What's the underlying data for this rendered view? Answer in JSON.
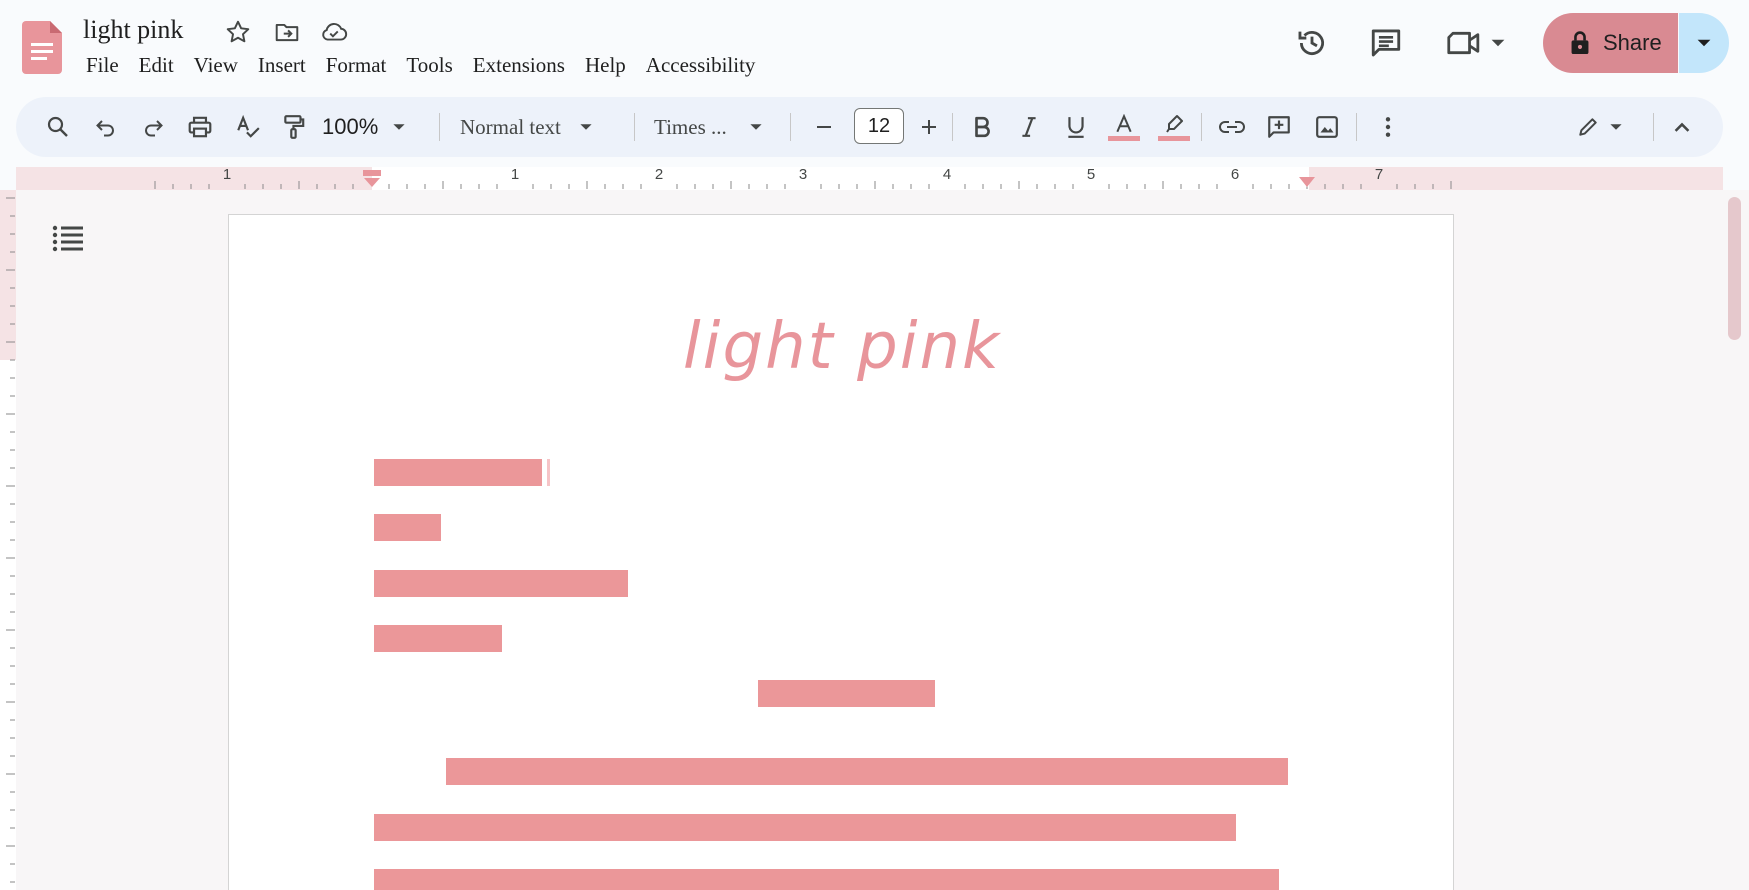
{
  "document": {
    "title": "light pink",
    "heading": "light pink"
  },
  "menu": {
    "items": [
      "File",
      "Edit",
      "View",
      "Insert",
      "Format",
      "Tools",
      "Extensions",
      "Help",
      "Accessibility"
    ]
  },
  "share": {
    "label": "Share"
  },
  "toolbar": {
    "zoom": "100%",
    "style": "Normal text",
    "font": "Times ...",
    "font_size": "12"
  },
  "ruler": {
    "labels": [
      "1",
      "1",
      "2",
      "3",
      "4",
      "5",
      "6",
      "7"
    ]
  },
  "colors": {
    "accent": "#d98a92",
    "heading": "#e8959b",
    "redaction": "#eb9799",
    "share_dropdown": "#c3e6fb",
    "toolbar_bg": "#edf2fa"
  },
  "icons": {
    "title_row": [
      "star-icon",
      "move-to-folder-icon",
      "cloud-saved-icon"
    ],
    "top_right": [
      "history-icon",
      "comment-icon",
      "video-call-icon",
      "lock-icon"
    ],
    "toolbar": [
      "search-icon",
      "undo-icon",
      "redo-icon",
      "print-icon",
      "spellcheck-icon",
      "paint-format-icon",
      "decrease-font-icon",
      "increase-font-icon",
      "bold-icon",
      "italic-icon",
      "underline-icon",
      "text-color-icon",
      "highlight-icon",
      "link-icon",
      "add-comment-icon",
      "insert-image-icon",
      "more-icon",
      "editing-mode-icon",
      "collapse-icon"
    ]
  }
}
